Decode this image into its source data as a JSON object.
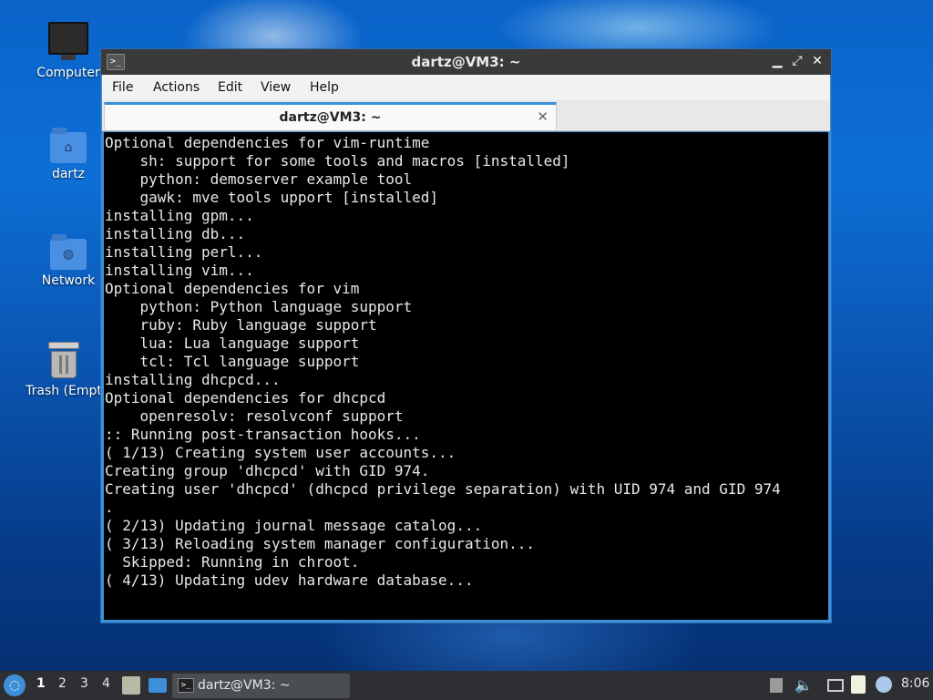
{
  "desktop": {
    "icons": [
      {
        "label": "Computer",
        "icon": "computer-icon"
      },
      {
        "label": "dartz",
        "icon": "home-folder-icon"
      },
      {
        "label": "Network",
        "icon": "network-folder-icon"
      },
      {
        "label": "Trash (Empt",
        "icon": "trash-icon"
      }
    ]
  },
  "window": {
    "title": "dartz@VM3: ~",
    "controls": {
      "minimize": "▁",
      "maximize": "⤢",
      "close": "✕"
    },
    "menu": [
      "File",
      "Actions",
      "Edit",
      "View",
      "Help"
    ],
    "tab": {
      "label": "dartz@VM3: ~",
      "close": "✕"
    },
    "terminal_lines": [
      "Optional dependencies for vim-runtime",
      "    sh: support for some tools and macros [installed]",
      "    python: demoserver example tool",
      "    gawk: mve tools upport [installed]",
      "installing gpm...",
      "installing db...",
      "installing perl...",
      "installing vim...",
      "Optional dependencies for vim",
      "    python: Python language support",
      "    ruby: Ruby language support",
      "    lua: Lua language support",
      "    tcl: Tcl language support",
      "installing dhcpcd...",
      "Optional dependencies for dhcpcd",
      "    openresolv: resolvconf support",
      ":: Running post-transaction hooks...",
      "( 1/13) Creating system user accounts...",
      "Creating group 'dhcpcd' with GID 974.",
      "Creating user 'dhcpcd' (dhcpcd privilege separation) with UID 974 and GID 974",
      ".",
      "( 2/13) Updating journal message catalog...",
      "( 3/13) Reloading system manager configuration...",
      "  Skipped: Running in chroot.",
      "( 4/13) Updating udev hardware database..."
    ]
  },
  "taskbar": {
    "workspaces": [
      "1",
      "2",
      "3",
      "4"
    ],
    "active_workspace": "1",
    "task_label": "dartz@VM3: ~",
    "clock": "8:06"
  },
  "colors": {
    "accent": "#3d8fd8",
    "terminal_bg": "#000000",
    "terminal_fg": "#e8e8e8",
    "titlebar_bg": "#3a3a3a",
    "taskbar_bg": "#2d2f33"
  }
}
